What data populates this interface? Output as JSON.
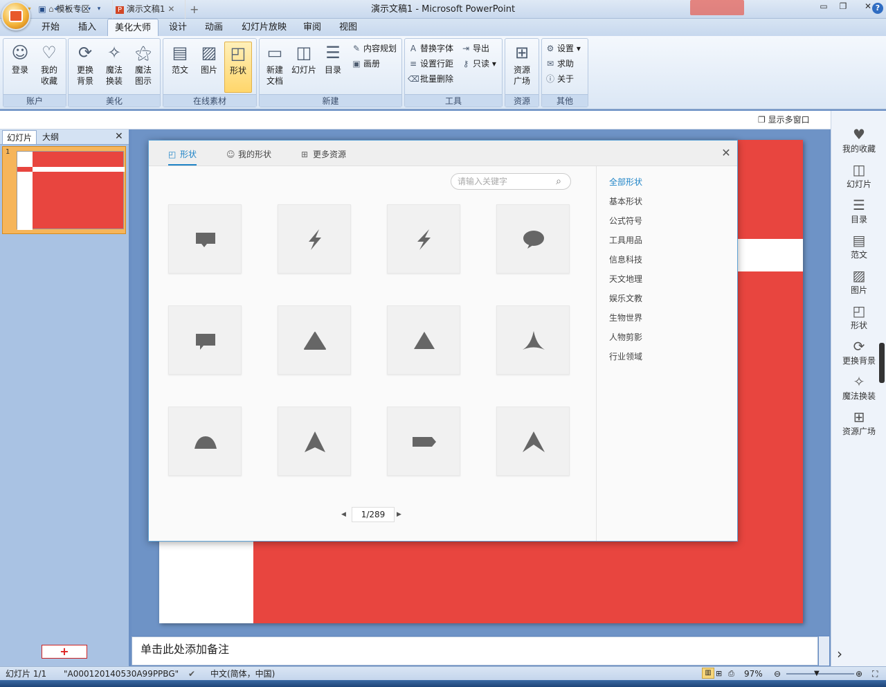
{
  "window": {
    "title": "演示文稿1 - Microsoft PowerPoint"
  },
  "ribbon_tabs": [
    "开始",
    "插入",
    "美化大师",
    "设计",
    "动画",
    "幻灯片放映",
    "审阅",
    "视图"
  ],
  "ribbon": {
    "groups": {
      "account": {
        "label": "账户",
        "login": "登录",
        "fav_1": "我的",
        "fav_2": "收藏"
      },
      "beautify": {
        "label": "美化",
        "bg_1": "更换",
        "bg_2": "背景",
        "magic_1": "魔法",
        "magic_2": "换装",
        "diagram_1": "魔法",
        "diagram_2": "图示"
      },
      "online": {
        "label": "在线素材",
        "sample": "范文",
        "picture": "图片",
        "shape": "形状"
      },
      "new": {
        "label": "新建",
        "newdoc_1": "新建",
        "newdoc_2": "文档",
        "slide": "幻灯片",
        "toc": "目录",
        "content_plan": "内容规划",
        "album": "画册"
      },
      "tools": {
        "label": "工具",
        "replace_font": "替换字体",
        "export": "导出",
        "line_spacing": "设置行距",
        "readonly": "只读",
        "batch_delete": "批量删除"
      },
      "resources": {
        "label": "资源",
        "square_1": "资源",
        "square_2": "广场"
      },
      "other": {
        "label": "其他",
        "settings": "设置",
        "help": "求助",
        "about": "关于"
      }
    }
  },
  "doc_tabs": {
    "template_zone": "模板专区",
    "doc": "演示文稿1",
    "multi_window": "显示多窗口"
  },
  "left_panel": {
    "tab_slides": "幻灯片",
    "tab_outline": "大纲",
    "slide_number": "1",
    "add_label": "+"
  },
  "notes": {
    "placeholder": "单击此处添加备注"
  },
  "right_bar": [
    "我的收藏",
    "幻灯片",
    "目录",
    "范文",
    "图片",
    "形状",
    "更换背景",
    "魔法换装",
    "资源广场"
  ],
  "dialog": {
    "tabs": [
      "形状",
      "我的形状",
      "更多资源"
    ],
    "search_placeholder": "请输入关键字",
    "pager": "1/289",
    "categories": [
      "全部形状",
      "基本形状",
      "公式符号",
      "工具用品",
      "信息科技",
      "天文地理",
      "娱乐文教",
      "生物世界",
      "人物剪影",
      "行业领域"
    ]
  },
  "status": {
    "slide": "幻灯片 1/1",
    "theme": "\"A000120140530A99PPBG\"",
    "language": "中文(简体，中国)",
    "zoom": "97%"
  },
  "colors": {
    "accent": "#1f84c7",
    "slide_red": "#e8453f"
  }
}
